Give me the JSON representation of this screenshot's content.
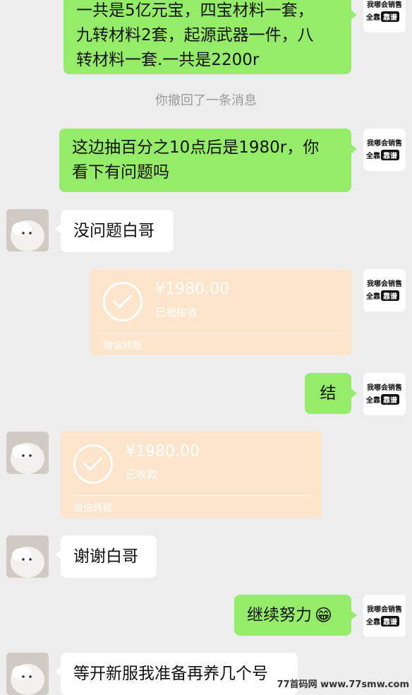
{
  "messages": {
    "m1": {
      "line1": "一共是5亿元宝，四宝材料一套，",
      "line2": "九转材料2套，起源武器一件，八",
      "line3": "转材料一套.一共是2200r"
    },
    "system_recall": "你撤回了一条消息",
    "m2": {
      "line1": "这边抽百分之10点后是1980r，你",
      "line2": "看下有问题吗"
    },
    "m3": "没问题白哥",
    "transfer1": {
      "amount": "¥1980.00",
      "status": "已被接收",
      "footer": "微信转账"
    },
    "m4": "结",
    "transfer2": {
      "amount": "¥1980.00",
      "status": "已收款",
      "footer": "微信转账"
    },
    "m5": "谢谢白哥",
    "m6": {
      "text": "继续努力",
      "emoji": "😁"
    },
    "m7": "等开新服我准备再养几个号"
  },
  "self_avatar": {
    "line1": "我哪会销售",
    "line2a": "全靠",
    "line2b": "靠谱"
  },
  "watermark": "77首码网 www.77smw.com",
  "colors": {
    "green": "#95ec69",
    "white": "#ffffff",
    "transfer": "#fde5cb",
    "bg": "#ededed"
  }
}
